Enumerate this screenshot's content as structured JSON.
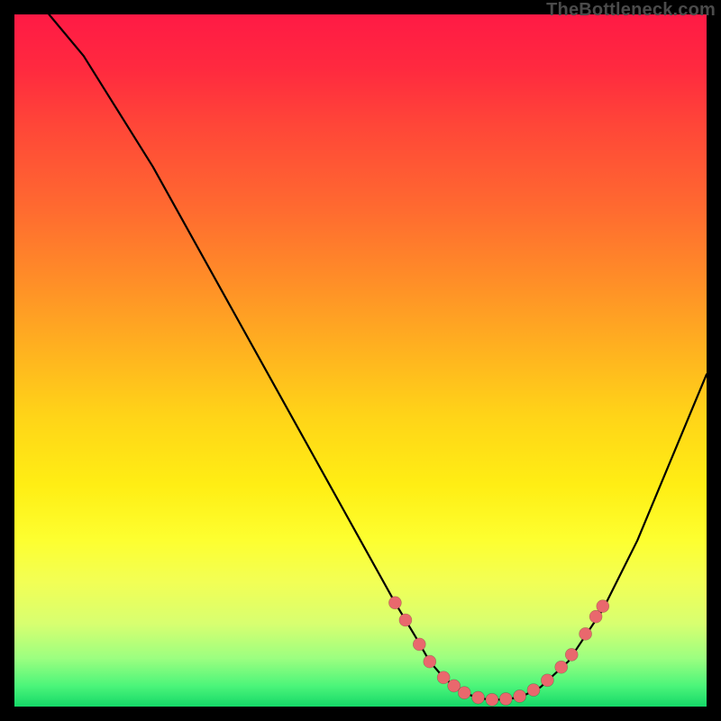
{
  "watermark": "TheBottleneck.com",
  "colors": {
    "background": "#000000",
    "gradient_top": "#ff1a45",
    "gradient_bottom": "#15d868",
    "curve": "#000000",
    "dots": "#e9686d"
  },
  "chart_data": {
    "type": "line",
    "title": "",
    "xlabel": "",
    "ylabel": "",
    "xlim": [
      0,
      100
    ],
    "ylim": [
      0,
      100
    ],
    "grid": false,
    "legend": false,
    "series": [
      {
        "name": "curve",
        "x": [
          5,
          10,
          15,
          20,
          25,
          30,
          35,
          40,
          45,
          50,
          55,
          58,
          60,
          62,
          64,
          66,
          68,
          70,
          73,
          76,
          80,
          85,
          90,
          95,
          100
        ],
        "y": [
          100,
          94,
          86,
          78,
          69,
          60,
          51,
          42,
          33,
          24,
          15,
          10,
          6.5,
          4.2,
          2.6,
          1.6,
          1.1,
          1.0,
          1.3,
          2.8,
          6.5,
          14,
          24,
          36,
          48
        ]
      }
    ],
    "annotations": {
      "data_points": [
        {
          "x": 55.0,
          "y": 15.0
        },
        {
          "x": 56.5,
          "y": 12.5
        },
        {
          "x": 58.5,
          "y": 9.0
        },
        {
          "x": 60.0,
          "y": 6.5
        },
        {
          "x": 62.0,
          "y": 4.2
        },
        {
          "x": 63.5,
          "y": 3.0
        },
        {
          "x": 65.0,
          "y": 2.0
        },
        {
          "x": 67.0,
          "y": 1.3
        },
        {
          "x": 69.0,
          "y": 1.0
        },
        {
          "x": 71.0,
          "y": 1.1
        },
        {
          "x": 73.0,
          "y": 1.5
        },
        {
          "x": 75.0,
          "y": 2.4
        },
        {
          "x": 77.0,
          "y": 3.8
        },
        {
          "x": 79.0,
          "y": 5.7
        },
        {
          "x": 80.5,
          "y": 7.5
        },
        {
          "x": 82.5,
          "y": 10.5
        },
        {
          "x": 84.0,
          "y": 13.0
        },
        {
          "x": 85.0,
          "y": 14.5
        }
      ]
    }
  }
}
